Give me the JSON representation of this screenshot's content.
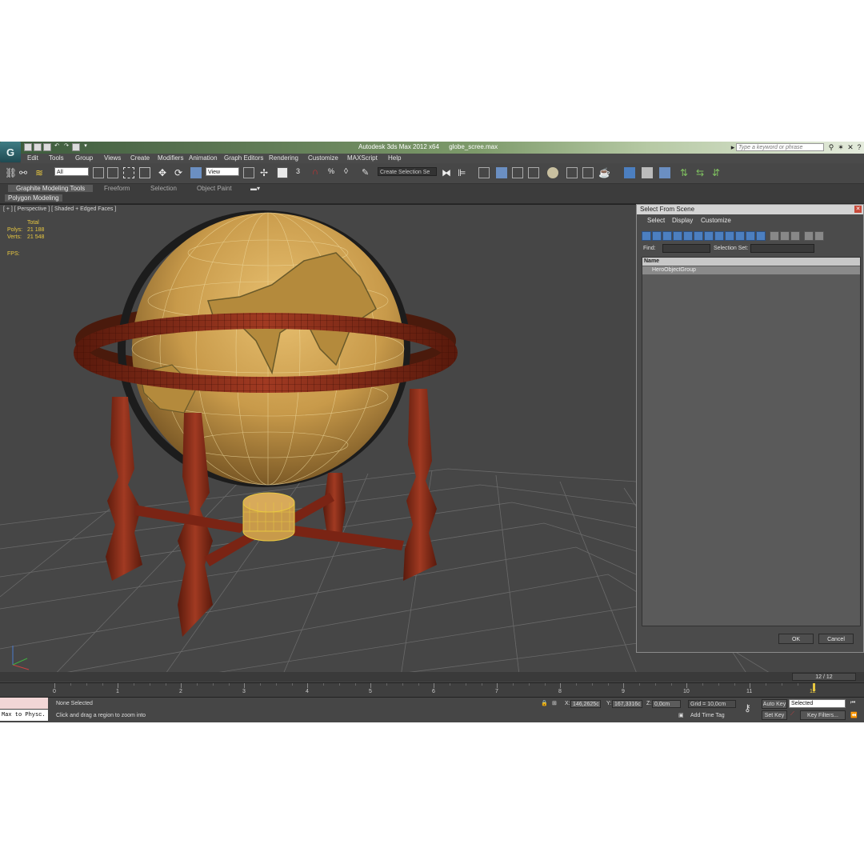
{
  "app": {
    "title": "Autodesk 3ds Max  2012 x64",
    "file": "globe_scree.max",
    "logo": "3ds-max-logo",
    "search_placeholder": "Type a keyword or phrase"
  },
  "menu": [
    "Edit",
    "Tools",
    "Group",
    "Views",
    "Create",
    "Modifiers",
    "Animation",
    "Graph Editors",
    "Rendering",
    "Customize",
    "MAXScript",
    "Help"
  ],
  "toolbar": {
    "filter_value": "All",
    "coord_value": "View",
    "selection_set_placeholder": "Create Selection Se",
    "snap_label": "3",
    "percent_snap_label": "%"
  },
  "ribbon": {
    "tabs": [
      "Graphite Modeling Tools",
      "Freeform",
      "Selection",
      "Object Paint"
    ],
    "active_panel": "Polygon Modeling"
  },
  "viewport": {
    "label": "[ + ] [ Perspective ] [ Shaded + Edged Faces ]",
    "stats_header": "Total",
    "polys_label": "Polys:",
    "polys_value": "21 188",
    "verts_label": "Verts:",
    "verts_value": "21 548",
    "fps_label": "FPS:"
  },
  "dialog": {
    "title": "Select From Scene",
    "menu": [
      "Select",
      "Display",
      "Customize"
    ],
    "find_label": "Find:",
    "selset_label": "Selection Set:",
    "column_header": "Name",
    "items": [
      "HeroObjectGroup"
    ],
    "ok": "OK",
    "cancel": "Cancel"
  },
  "timeline": {
    "frame_display": "12 / 12",
    "ticks": [
      "0",
      "1",
      "2",
      "3",
      "4",
      "5",
      "6",
      "7",
      "8",
      "9",
      "10",
      "11",
      "12"
    ]
  },
  "status": {
    "script_output": "Max to Physc.",
    "selection_status": "None Selected",
    "prompt": "Click and drag a region to zoom into",
    "x_label": "X:",
    "x_value": "146,2625c",
    "y_label": "Y:",
    "y_value": "167,3316c",
    "z_label": "Z:",
    "z_value": "0,0cm",
    "grid": "Grid = 10,0cm",
    "add_time_tag": "Add Time Tag",
    "auto_key": "Auto Key",
    "set_key": "Set Key",
    "key_mode": "Selected",
    "key_filters": "Key Filters..."
  },
  "colors": {
    "viewport_bg": "#464646",
    "globe": "#c89a4a",
    "wood": "#8a2a18",
    "selection_wire": "#e8c840",
    "stats_text": "#e8c840"
  }
}
